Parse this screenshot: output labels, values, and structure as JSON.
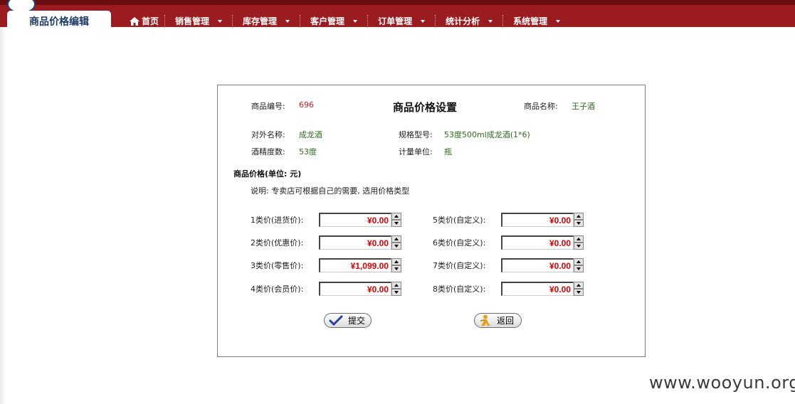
{
  "header": {
    "active_tab": "商品价格编辑",
    "menu": [
      {
        "label": "首页",
        "icon": "home-icon"
      },
      {
        "label": "销售管理"
      },
      {
        "label": "库存管理"
      },
      {
        "label": "客户管理"
      },
      {
        "label": "订单管理"
      },
      {
        "label": "统计分析"
      },
      {
        "label": "系统管理"
      }
    ]
  },
  "panel": {
    "title": "商品价格设置",
    "product_id_label": "商品编号:",
    "product_id": "696",
    "product_name_label": "商品名称:",
    "product_name": "王子酒",
    "external_name_label": "对外名称:",
    "external_name": "成龙酒",
    "spec_label": "规格型号:",
    "spec": "53度500ml成龙酒(1*6)",
    "alcohol_label": "酒精度数:",
    "alcohol": "53度",
    "unit_label": "计量单位:",
    "unit": "瓶",
    "section_title": "商品价格(单位: 元)",
    "note": "说明: 专卖店可根据自己的需要, 选用价格类型",
    "prices_left": [
      {
        "label": "1类价(进货价):",
        "value": "¥0.00"
      },
      {
        "label": "2类价(优惠价):",
        "value": "¥0.00"
      },
      {
        "label": "3类价(零售价):",
        "value": "¥1,099.00"
      },
      {
        "label": "4类价(会员价):",
        "value": "¥0.00"
      }
    ],
    "prices_right": [
      {
        "label": "5类价(自定义):",
        "value": "¥0.00"
      },
      {
        "label": "6类价(自定义):",
        "value": "¥0.00"
      },
      {
        "label": "7类价(自定义):",
        "value": "¥0.00"
      },
      {
        "label": "8类价(自定义):",
        "value": "¥0.00"
      }
    ],
    "submit_label": "提交",
    "back_label": "返回"
  },
  "watermark": "www.wooyun.org",
  "colors": {
    "header_bg": "#9b1c20",
    "accent_red": "#d21a1a",
    "value_green": "#2f6b1f",
    "tab_text": "#1f3c66"
  }
}
